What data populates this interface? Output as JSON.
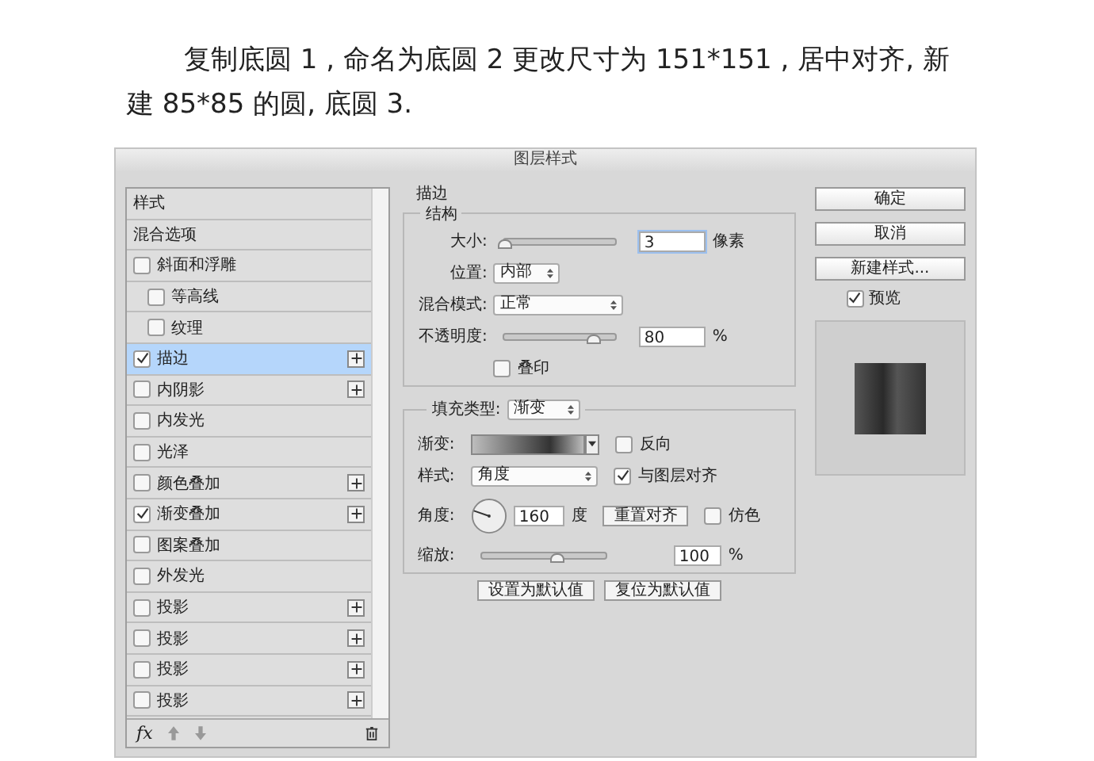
{
  "heading": "复制底圆 1 , 命名为底圆 2  更改尺寸为 151*151 , 居中对齐, 新建 85*85 的圆, 底圆 3.",
  "dialog": {
    "title": "图层样式",
    "styles": [
      {
        "label": "样式",
        "kind": "plain",
        "selected": false
      },
      {
        "label": "混合选项",
        "kind": "plain",
        "selected": false
      },
      {
        "label": "斜面和浮雕",
        "kind": "check",
        "checked": false,
        "selected": false,
        "add": false,
        "children": [
          {
            "label": "等高线",
            "kind": "check",
            "checked": false,
            "selected": false,
            "add": false
          },
          {
            "label": "纹理",
            "kind": "check",
            "checked": false,
            "selected": false,
            "add": false
          }
        ]
      },
      {
        "label": "描边",
        "kind": "check",
        "checked": true,
        "selected": true,
        "add": true
      },
      {
        "label": "内阴影",
        "kind": "check",
        "checked": false,
        "selected": false,
        "add": true
      },
      {
        "label": "内发光",
        "kind": "check",
        "checked": false,
        "selected": false,
        "add": false
      },
      {
        "label": "光泽",
        "kind": "check",
        "checked": false,
        "selected": false,
        "add": false
      },
      {
        "label": "颜色叠加",
        "kind": "check",
        "checked": false,
        "selected": false,
        "add": true
      },
      {
        "label": "渐变叠加",
        "kind": "check",
        "checked": true,
        "selected": false,
        "add": true
      },
      {
        "label": "图案叠加",
        "kind": "check",
        "checked": false,
        "selected": false,
        "add": false
      },
      {
        "label": "外发光",
        "kind": "check",
        "checked": false,
        "selected": false,
        "add": false
      },
      {
        "label": "投影",
        "kind": "check",
        "checked": false,
        "selected": false,
        "add": true
      },
      {
        "label": "投影",
        "kind": "check",
        "checked": false,
        "selected": false,
        "add": true
      },
      {
        "label": "投影",
        "kind": "check",
        "checked": false,
        "selected": false,
        "add": true
      },
      {
        "label": "投影",
        "kind": "check",
        "checked": false,
        "selected": false,
        "add": true
      }
    ],
    "fx": "fx",
    "stroke": {
      "title": "描边",
      "structure": {
        "title": "结构",
        "size": {
          "label": "大小:",
          "level": 0.0,
          "value": "3",
          "unit": "像素"
        },
        "position": {
          "label": "位置:",
          "value": "内部"
        },
        "blend": {
          "label": "混合模式:",
          "value": "正常"
        },
        "opacity": {
          "label": "不透明度:",
          "level": 0.8,
          "value": "80",
          "unit": "%"
        },
        "overprint": {
          "label": "叠印",
          "checked": false
        }
      },
      "fill": {
        "label": "填充类型:",
        "value": "渐变",
        "gradient": {
          "label": "渐变:"
        },
        "reverse": {
          "label": "反向",
          "checked": false
        },
        "style": {
          "label": "样式:",
          "value": "角度"
        },
        "align": {
          "label": "与图层对齐",
          "checked": true
        },
        "angle": {
          "label": "角度:",
          "value": "160",
          "unit": "度"
        },
        "reset": "重置对齐",
        "dither": {
          "label": "仿色",
          "checked": false
        },
        "scale": {
          "label": "缩放:",
          "level": 0.6,
          "value": "100",
          "unit": "%"
        }
      },
      "buttons": [
        "设置为默认值",
        "复位为默认值"
      ]
    },
    "actions": [
      "确定",
      "取消",
      "新建样式..."
    ],
    "preview": {
      "label": "预览",
      "checked": true
    }
  }
}
